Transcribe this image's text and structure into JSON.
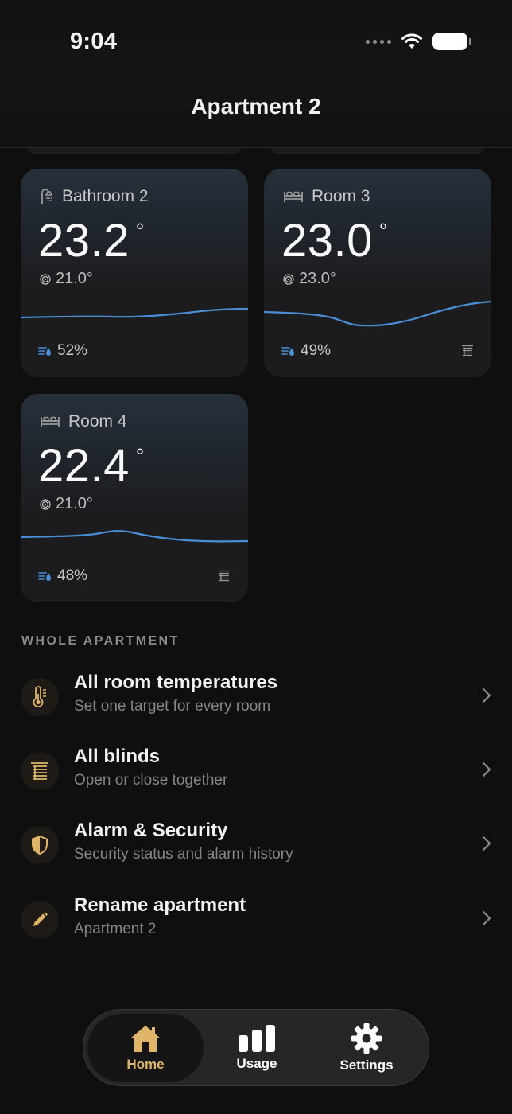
{
  "status_bar": {
    "time": "9:04"
  },
  "header": {
    "title": "Apartment 2"
  },
  "rooms": [
    {
      "name": "Bathroom 2",
      "icon": "shower-icon",
      "temperature": "23.2",
      "degree": "°",
      "target": "21.0°",
      "humidity": "52%",
      "has_blinds": false
    },
    {
      "name": "Room 3",
      "icon": "bed-icon",
      "temperature": "23.0",
      "degree": "°",
      "target": "23.0°",
      "humidity": "49%",
      "has_blinds": true
    },
    {
      "name": "Room 4",
      "icon": "bed-icon",
      "temperature": "22.4",
      "degree": "°",
      "target": "21.0°",
      "humidity": "48%",
      "has_blinds": true
    }
  ],
  "section": {
    "title": "WHOLE APARTMENT",
    "items": [
      {
        "title": "All room temperatures",
        "subtitle": "Set one target for every room",
        "icon": "thermometer-icon"
      },
      {
        "title": "All blinds",
        "subtitle": "Open or close together",
        "icon": "blinds-icon"
      },
      {
        "title": "Alarm & Security",
        "subtitle": "Security status and alarm history",
        "icon": "shield-icon"
      },
      {
        "title": "Rename apartment",
        "subtitle": "Apartment 2",
        "icon": "pencil-icon"
      }
    ]
  },
  "tabbar": {
    "tabs": [
      {
        "label": "Home",
        "icon": "home-icon",
        "active": true
      },
      {
        "label": "Usage",
        "icon": "bar-chart-icon",
        "active": false
      },
      {
        "label": "Settings",
        "icon": "gear-icon",
        "active": false
      }
    ]
  },
  "colors": {
    "accent": "#e0b56a",
    "sparkline": "#4a8fd6",
    "background": "#0f0f0f",
    "card": "#1c1c1e"
  }
}
